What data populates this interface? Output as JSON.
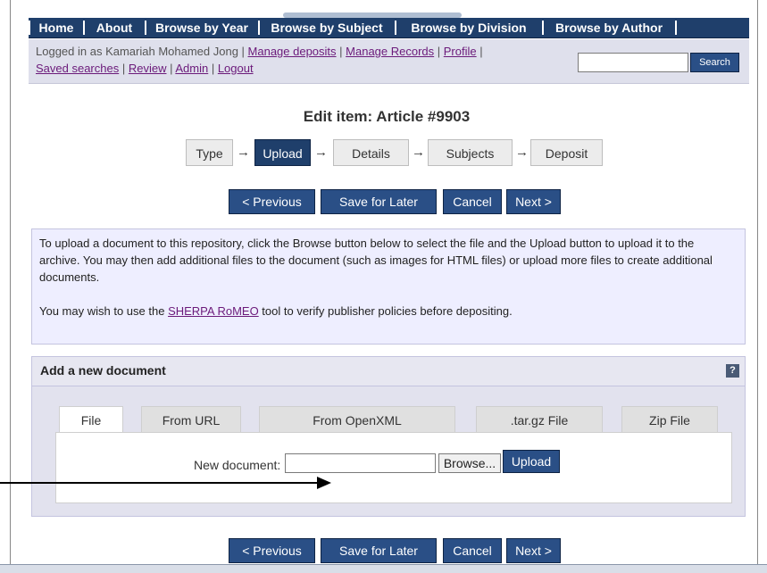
{
  "nav": {
    "items": [
      "Home",
      "About",
      "Browse by Year",
      "Browse by Subject",
      "Browse by Division",
      "Browse by Author"
    ]
  },
  "login": {
    "prefix": "Logged in as Kamariah Mohamed Jong | ",
    "manage_deposits": "Manage deposits",
    "sep1": " | ",
    "manage_records": "Manage Records",
    "sep2": " | ",
    "profile": "Profile",
    "sep3": " |",
    "saved_searches": "Saved searches",
    "sep4": " | ",
    "review": "Review",
    "sep5": " | ",
    "admin": "Admin",
    "sep6": " | ",
    "logout": "Logout"
  },
  "search": {
    "button": "Search",
    "value": ""
  },
  "page_title": "Edit item: Article #9903",
  "steps": [
    "Type",
    "Upload",
    "Details",
    "Subjects",
    "Deposit"
  ],
  "arrow_glyph": "→",
  "buttons": {
    "previous": "< Previous",
    "save": "Save for Later",
    "cancel": "Cancel",
    "next": "Next >"
  },
  "info": {
    "p1": "To upload a document to this repository, click the Browse button below to select the file and the Upload button to upload it to the archive. You may then add additional files to the document (such as images for HTML files) or upload more files to create additional documents.",
    "p2_prefix": "You may wish to use the ",
    "p2_link": "SHERPA RoMEO",
    "p2_suffix": " tool to verify publisher policies before depositing."
  },
  "add_doc": {
    "title": "Add a new document",
    "help": "?",
    "tabs": [
      "File",
      "From URL",
      "From OpenXML",
      ".tar.gz File",
      "Zip File"
    ],
    "new_doc_label": "New document:",
    "file_value": "",
    "browse": "Browse...",
    "upload": "Upload"
  },
  "colors": {
    "nav_bg": "#1f3f6b",
    "button_bg": "#2a4f86",
    "link": "#6b1a7a",
    "info_bg": "#eeeeff"
  },
  "icons": {
    "help": "help-icon",
    "annotation": "annotation-arrow-icon"
  }
}
